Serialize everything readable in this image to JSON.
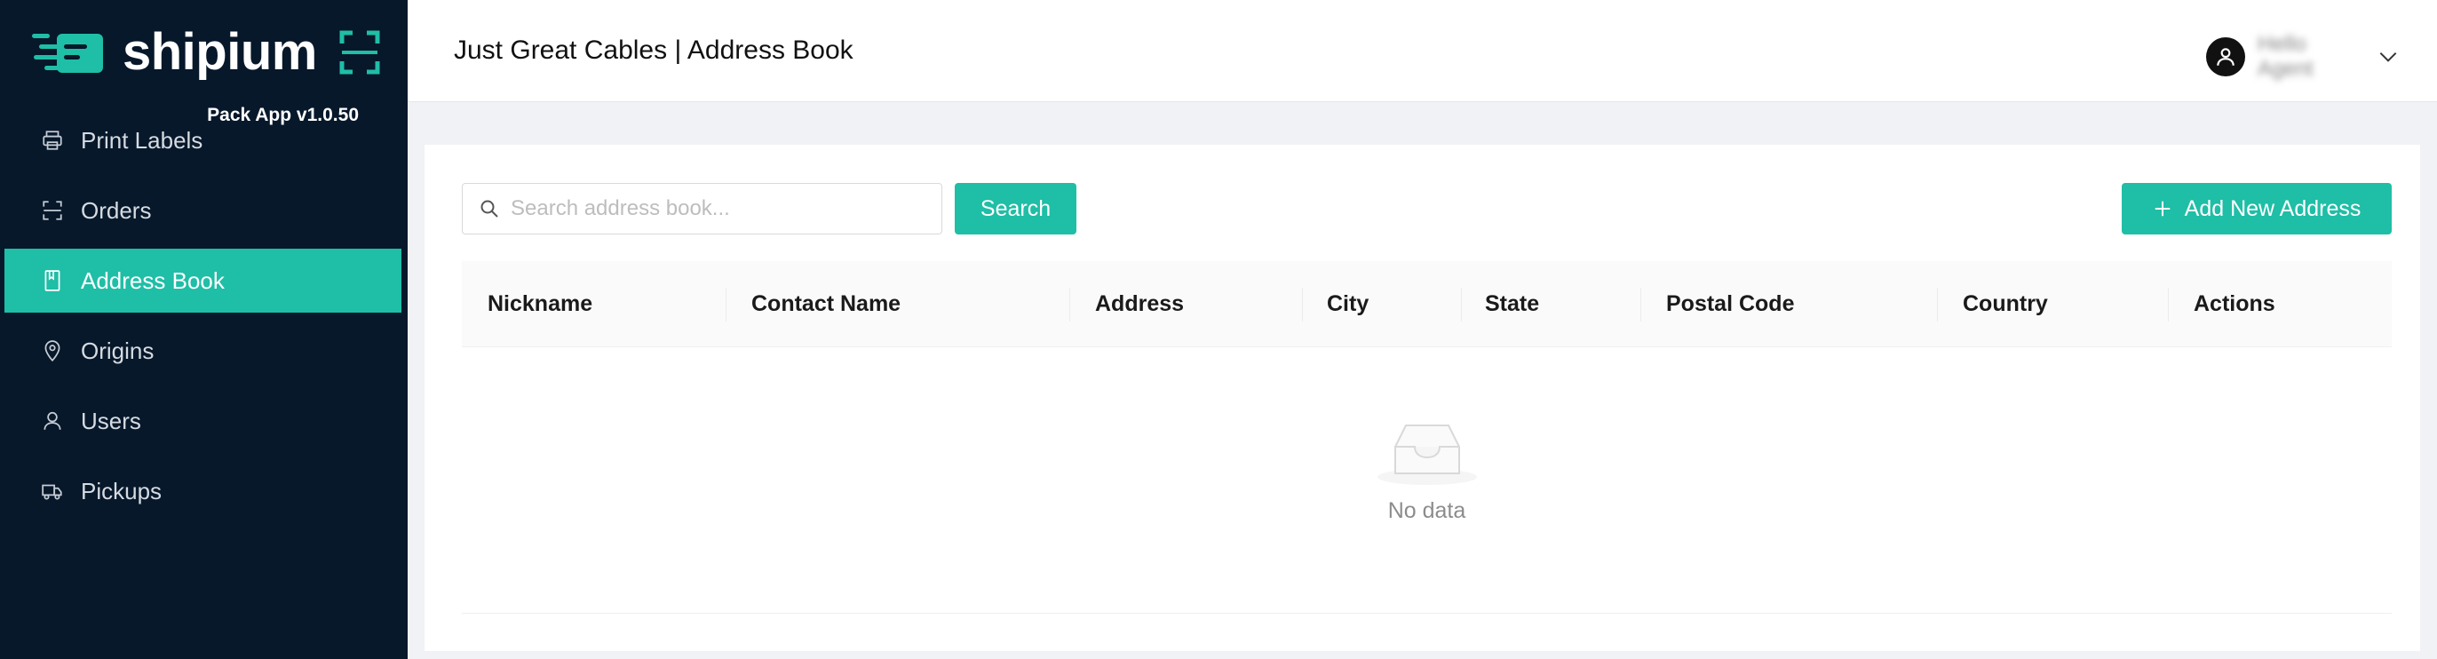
{
  "brand": {
    "name": "shipium",
    "version": "Pack App v1.0.50",
    "accent": "#1fbea6",
    "sidebar_bg": "#07182b"
  },
  "nav": {
    "items": [
      {
        "label": "Print Labels",
        "icon": "printer-icon",
        "active": false
      },
      {
        "label": "Orders",
        "icon": "scan-icon",
        "active": false
      },
      {
        "label": "Address Book",
        "icon": "book-icon",
        "active": true
      },
      {
        "label": "Origins",
        "icon": "location-pin-icon",
        "active": false
      },
      {
        "label": "Users",
        "icon": "user-icon",
        "active": false
      },
      {
        "label": "Pickups",
        "icon": "truck-icon",
        "active": false
      }
    ]
  },
  "header": {
    "title": "Just Great Cables | Address Book",
    "user_name": "Hello Agent"
  },
  "toolbar": {
    "search_placeholder": "Search address book...",
    "search_value": "",
    "search_label": "Search",
    "add_label": "Add New Address"
  },
  "table": {
    "columns": [
      "Nickname",
      "Contact Name",
      "Address",
      "City",
      "State",
      "Postal Code",
      "Country",
      "Actions"
    ],
    "rows": [],
    "empty_text": "No data"
  }
}
